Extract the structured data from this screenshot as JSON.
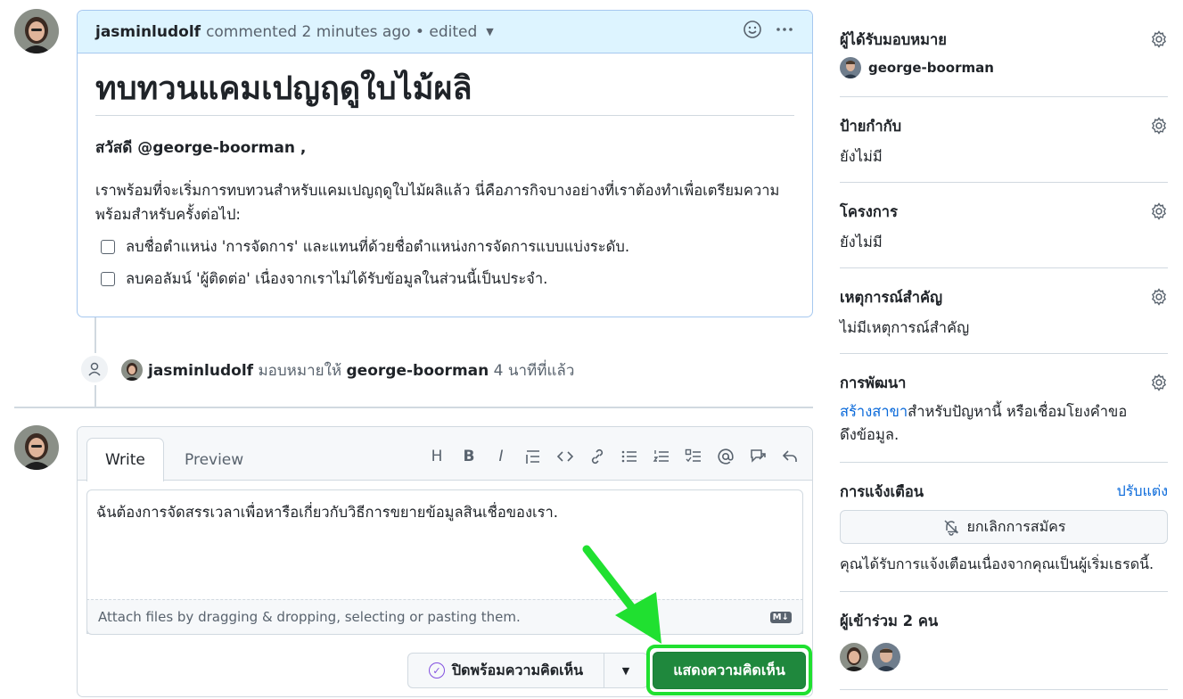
{
  "comment": {
    "author": "jasminludolf",
    "meta": "commented 2 minutes ago • edited",
    "title": "ทบทวนแคมเปญฤดูใบไม้ผลิ",
    "greeting": "สวัสดี @george-boorman ,",
    "paragraph": "เราพร้อมที่จะเริ่มการทบทวนสำหรับแคมเปญฤดูใบไม้ผลิแล้ว นี่คือภารกิจบางอย่างที่เราต้องทำเพื่อเตรียมความพร้อมสำหรับครั้งต่อไป:",
    "tasks": [
      "ลบชื่อตำแหน่ง 'การจัดการ' และแทนที่ด้วยชื่อตำแหน่งการจัดการแบบแบ่งระดับ.",
      "ลบคอลัมน์ 'ผู้ติดต่อ' เนื่องจากเราไม่ได้รับข้อมูลในส่วนนี้เป็นประจำ."
    ]
  },
  "event": {
    "actor": "jasminludolf",
    "action": "มอบหมายให้",
    "target": "george-boorman",
    "time": "4 นาทีที่แล้ว"
  },
  "editor": {
    "tab_write": "Write",
    "tab_preview": "Preview",
    "text": "ฉันต้องการจัดสรรเวลาเพื่อหารือเกี่ยวกับวิธีการขยายข้อมูลสินเชื่อของเรา.",
    "attach_hint": "Attach files by dragging & dropping, selecting or pasting them.",
    "md_badge": "M↓",
    "tool_heading": "H",
    "tool_bold": "B",
    "tool_italic": "I",
    "close_label": "ปิดพร้อมความคิดเห็น",
    "submit_label": "แสดงความคิดเห็น",
    "dropdown_caret": "▼",
    "close_check": "✓"
  },
  "sidebar": {
    "assignees": {
      "heading": "ผู้ได้รับมอบหมาย",
      "name": "george-boorman"
    },
    "labels": {
      "heading": "ป้ายกำกับ",
      "value": "ยังไม่มี"
    },
    "projects": {
      "heading": "โครงการ",
      "value": "ยังไม่มี"
    },
    "milestone": {
      "heading": "เหตุการณ์สำคัญ",
      "value": "ไม่มีเหตุการณ์สำคัญ"
    },
    "development": {
      "heading": "การพัฒนา",
      "link": "สร้างสาขา",
      "text": "สำหรับปัญหานี้ หรือเชื่อมโยงคำขอดึงข้อมูล."
    },
    "notifications": {
      "heading": "การแจ้งเตือน",
      "customize": "ปรับแต่ง",
      "button": "ยกเลิกการสมัคร",
      "reason": "คุณได้รับการแจ้งเตือนเนื่องจากคุณเป็นผู้เริ่มเธรดนี้."
    },
    "participants": {
      "heading": "ผู้เข้าร่วม 2 คน"
    }
  },
  "colors": {
    "accent": "#0969da",
    "submit": "#1f883d",
    "highlight": "#20e030",
    "header_bg": "#ddf4ff"
  },
  "icons": [
    "smiley-icon",
    "kebab-horizontal-icon",
    "person-icon",
    "gear-icon",
    "bell-slash-icon",
    "check-circle-icon",
    "triangle-down-icon",
    "arrow-annotation"
  ]
}
